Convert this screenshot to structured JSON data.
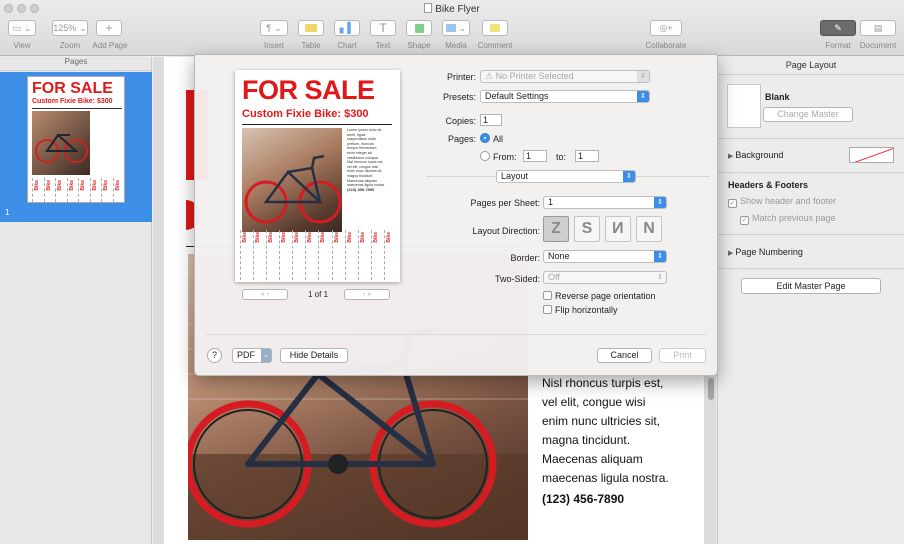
{
  "window": {
    "title": "Bike Flyer"
  },
  "toolbar": {
    "view": "View",
    "zoom": "Zoom",
    "zoom_value": "125%",
    "add_page": "Add Page",
    "insert": "Insert",
    "table": "Table",
    "chart": "Chart",
    "text": "Text",
    "shape": "Shape",
    "media": "Media",
    "comment": "Comment",
    "collaborate": "Collaborate",
    "format": "Format",
    "document": "Document"
  },
  "sidebar": {
    "header": "Pages",
    "page_number": "1"
  },
  "flyer": {
    "headline": "FOR SALE",
    "subhead": "Custom Fixie Bike: $300",
    "tab_label": "Bike",
    "body_lines": [
      "Nisl rhoncus turpis est,",
      "vel elit, congue wisi",
      "enim nunc ultricies sit,",
      "magna tincidunt.",
      "Maecenas aliquam",
      "maecenas ligula nostra."
    ],
    "phone": "(123) 456-7890",
    "preview_body": [
      "Lorem ipsum dolor sit",
      "amet, ligula",
      "suspendisse nulla",
      "pretium, rhoncus",
      "tempor fermentum,",
      "enim integer ad",
      "vestibulum volutpat.",
      "Nisl rhoncus turpis est,",
      "vel elit, congue wisi",
      "enim nunc ultricies sit,",
      "magna tincidunt.",
      "Maecenas aliquam",
      "maecenas ligula nostra."
    ]
  },
  "print_dialog": {
    "printer_label": "Printer:",
    "printer_value": "⚠ No Printer Selected",
    "presets_label": "Presets:",
    "presets_value": "Default Settings",
    "copies_label": "Copies:",
    "copies_value": "1",
    "pages_label": "Pages:",
    "pages_all": "All",
    "pages_from": "From:",
    "from_value": "1",
    "pages_to": "to:",
    "to_value": "1",
    "section_value": "Layout",
    "pps_label": "Pages per Sheet:",
    "pps_value": "1",
    "layout_dir_label": "Layout Direction:",
    "border_label": "Border:",
    "border_value": "None",
    "two_sided_label": "Two-Sided:",
    "two_sided_value": "Off",
    "reverse": "Reverse page orientation",
    "flip": "Flip horizontally",
    "page_count": "1 of 1",
    "help": "?",
    "pdf": "PDF",
    "hide_details": "Hide Details",
    "cancel": "Cancel",
    "print": "Print"
  },
  "inspector": {
    "header": "Page Layout",
    "master_name": "Blank",
    "change_master": "Change Master",
    "background": "Background",
    "headers_footers": "Headers & Footers",
    "show_hf": "Show header and footer",
    "match_prev": "Match previous page",
    "page_numbering": "Page Numbering",
    "edit_master": "Edit Master Page"
  },
  "colors": {
    "accent": "#3d8ee6",
    "flyer_red": "#e01818"
  }
}
